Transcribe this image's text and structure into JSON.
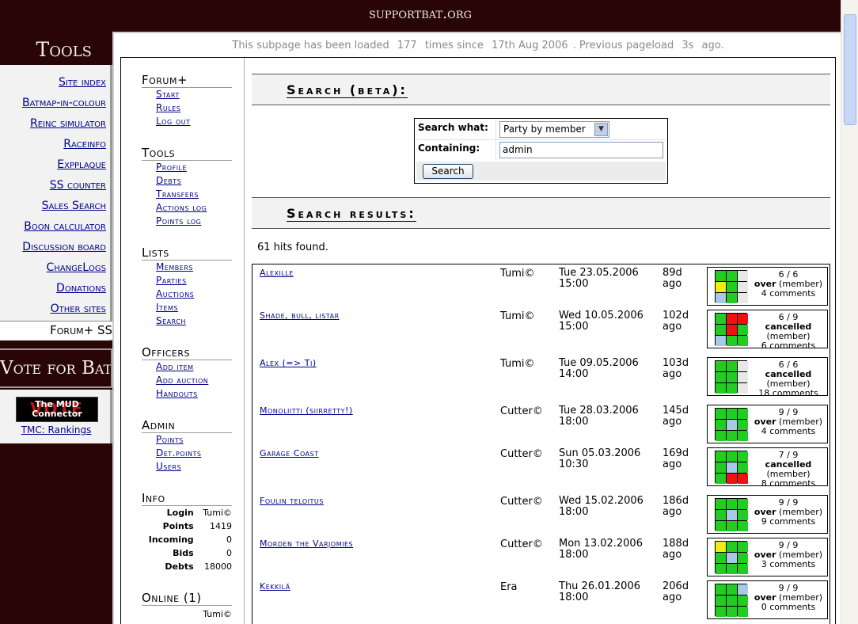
{
  "site": {
    "logo": "supportbat.org"
  },
  "sidebar": {
    "title": "Tools",
    "items": [
      "Site index",
      "Batmap-in-colour",
      "Reinc simulator",
      "Raceinfo",
      "Expplaque",
      "SS counter",
      "Sales Search",
      "Boon calculator",
      "Discussion board",
      "ChangeLogs",
      "Donations",
      "Other sites"
    ],
    "current": "Forum+ SS",
    "vote_title": "Vote for Bat",
    "badge_mud": "The MUD Connector",
    "badge_vote": "VOTE",
    "tmc_link": "TMC: Rankings"
  },
  "load_note": {
    "prefix": "This subpage has been loaded",
    "count": "177",
    "mid": "times since",
    "since": "17th Aug 2006",
    "prev": ". Previous pageload",
    "ago": "3s",
    "suffix": "ago."
  },
  "submenu": {
    "forum": {
      "head": "Forum+",
      "links": [
        "Start",
        "Rules",
        "Log out"
      ]
    },
    "tools": {
      "head": "Tools",
      "links": [
        "Profile",
        "Debts",
        "Transfers",
        "Actions log",
        "Points log"
      ]
    },
    "lists": {
      "head": "Lists",
      "links": [
        "Members",
        "Parties",
        "Auctions",
        "Items",
        "Search"
      ]
    },
    "officers": {
      "head": "Officers",
      "links": [
        "Add item",
        "Add auction",
        "Handouts"
      ]
    },
    "admin": {
      "head": "Admin",
      "links": [
        "Points",
        "Det.points",
        "Users"
      ]
    },
    "info": {
      "head": "Info",
      "rows": [
        {
          "k": "Login",
          "v": "Tumi©"
        },
        {
          "k": "Points",
          "v": "1419"
        },
        {
          "k": "Incoming",
          "v": "0"
        },
        {
          "k": "Bids",
          "v": "0"
        },
        {
          "k": "Debts",
          "v": "18000"
        }
      ]
    },
    "online": {
      "head": "Online (1)",
      "user": "Tumi©"
    }
  },
  "search": {
    "title": "Search (beta):",
    "what_label": "Search what:",
    "what_value": "Party by member",
    "containing_label": "Containing:",
    "containing_value": "admin",
    "button": "Search"
  },
  "results": {
    "title": "Search results:",
    "hits": "61 hits found.",
    "rows": [
      {
        "name": "Alexille",
        "leader": "Tumi©",
        "date": "Tue 23.05.2006",
        "time": "15:00",
        "ago": "89d",
        "ago2": "ago",
        "count": "6 / 6",
        "status": "over",
        "kind": "(member)",
        "comments": "4 comments",
        "cells": [
          "g",
          "g",
          "w",
          "y",
          "g",
          "w",
          "b",
          "g",
          "w"
        ]
      },
      {
        "name": "Shade, bull, listar",
        "leader": "Tumi©",
        "date": "Wed 10.05.2006",
        "time": "15:00",
        "ago": "102d",
        "ago2": "ago",
        "count": "6 / 9",
        "status": "cancelled",
        "kind": "(member)",
        "comments": "6 comments",
        "cells": [
          "g",
          "r",
          "r",
          "g",
          "r",
          "g",
          "b",
          "g",
          "g"
        ]
      },
      {
        "name": "Alex (=> Ti)",
        "leader": "Tumi©",
        "date": "Tue 09.05.2006",
        "time": "14:00",
        "ago": "103d",
        "ago2": "ago",
        "count": "6 / 6",
        "status": "cancelled",
        "kind": "(member)",
        "comments": "18 comments",
        "cells": [
          "g",
          "g",
          "w",
          "g",
          "g",
          "w",
          "g",
          "g",
          "w"
        ]
      },
      {
        "name": "Monoliitti (siirretty!)",
        "leader": "Cutter©",
        "date": "Tue 28.03.2006",
        "time": "18:00",
        "ago": "145d",
        "ago2": "ago",
        "count": "9 / 9",
        "status": "over",
        "kind": "(member)",
        "comments": "4 comments",
        "cells": [
          "g",
          "g",
          "g",
          "g",
          "b",
          "g",
          "g",
          "g",
          "g"
        ]
      },
      {
        "name": "Garage Coast",
        "leader": "Cutter©",
        "date": "Sun 05.03.2006",
        "time": "10:30",
        "ago": "169d",
        "ago2": "ago",
        "count": "7 / 9",
        "status": "cancelled",
        "kind": "(member)",
        "comments": "8 comments",
        "cells": [
          "g",
          "g",
          "g",
          "g",
          "b",
          "g",
          "g",
          "r",
          "r"
        ]
      },
      {
        "name": "Foulin teloitus",
        "leader": "Cutter©",
        "date": "Wed 15.02.2006",
        "time": "18:00",
        "ago": "186d",
        "ago2": "ago",
        "count": "9 / 9",
        "status": "over",
        "kind": "(member)",
        "comments": "9 comments",
        "cells": [
          "g",
          "g",
          "g",
          "g",
          "b",
          "g",
          "g",
          "g",
          "g"
        ]
      },
      {
        "name": "Morden the Varjomies",
        "leader": "Cutter©",
        "date": "Mon 13.02.2006",
        "time": "18:00",
        "ago": "188d",
        "ago2": "ago",
        "count": "9 / 9",
        "status": "over",
        "kind": "(member)",
        "comments": "3 comments",
        "cells": [
          "y",
          "g",
          "g",
          "g",
          "b",
          "g",
          "g",
          "g",
          "g"
        ]
      },
      {
        "name": "Kekkilä",
        "leader": "Era",
        "date": "Thu 26.01.2006",
        "time": "18:00",
        "ago": "206d",
        "ago2": "ago",
        "count": "9 / 9",
        "status": "over",
        "kind": "(member)",
        "comments": "0 comments",
        "cells": [
          "g",
          "g",
          "b",
          "g",
          "g",
          "g",
          "g",
          "g",
          "g"
        ]
      }
    ]
  },
  "colors": {
    "g": "#22cc22",
    "r": "#ee1111",
    "y": "#eeee11",
    "b": "#a8c8e8",
    "w": "#e8e8e8"
  }
}
